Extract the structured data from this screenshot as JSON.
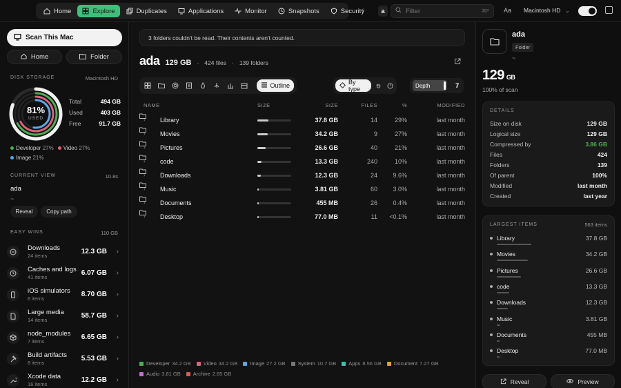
{
  "nav": {
    "items": [
      {
        "label": "Home",
        "icon": "home-icon",
        "active": false
      },
      {
        "label": "Explore",
        "icon": "grid-icon",
        "active": true
      },
      {
        "label": "Duplicates",
        "icon": "copy-icon",
        "active": false
      },
      {
        "label": "Applications",
        "icon": "monitor-icon",
        "active": false
      },
      {
        "label": "Monitor",
        "icon": "pulse-icon",
        "active": false
      },
      {
        "label": "Snapshots",
        "icon": "clock-icon",
        "active": false
      },
      {
        "label": "Security",
        "icon": "shield-icon",
        "active": false
      }
    ],
    "crumb": "a",
    "filter_placeholder": "Filter",
    "filter_shortcut": "⌘F",
    "font_toggle": "Aa",
    "volume": "Macintosh HD"
  },
  "sidebar": {
    "scan_label": "Scan This Mac",
    "home_label": "Home",
    "folder_label": "Folder",
    "disk_label": "Disk Storage",
    "disk_volume": "Macintosh HD",
    "ring_pct": "81%",
    "ring_sub": "USED",
    "used_fraction": 0.81,
    "total_label": "Total",
    "total_value": "494 GB",
    "used_label": "Used",
    "used_value": "403 GB",
    "free_label": "Free",
    "free_value": "91.7 GB",
    "legend": [
      {
        "name": "Developer",
        "pct": "27%",
        "color": "#4caf50"
      },
      {
        "name": "Video",
        "pct": "27%",
        "color": "#e0607e"
      },
      {
        "name": "Image",
        "pct": "21%",
        "color": "#5aa9e6"
      }
    ],
    "current_view_label": "Current View",
    "current_view_time": "10.8s",
    "current_view_name": "ada",
    "current_view_path": "~",
    "reveal_label": "Reveal",
    "copy_path_label": "Copy path",
    "easy_wins_label": "Easy Wins",
    "easy_wins_total": "110 GB",
    "wins": [
      {
        "name": "Downloads",
        "sub": "24 items",
        "value": "12.3 GB",
        "icon": "download-icon"
      },
      {
        "name": "Caches and logs",
        "sub": "41 items",
        "value": "6.07 GB",
        "icon": "clock-icon"
      },
      {
        "name": "iOS simulators",
        "sub": "6 items",
        "value": "8.70 GB",
        "icon": "phone-icon"
      },
      {
        "name": "Large media",
        "sub": "14 items",
        "value": "58.7 GB",
        "icon": "file-icon"
      },
      {
        "name": "node_modules",
        "sub": "7 items",
        "value": "6.65 GB",
        "icon": "package-icon"
      },
      {
        "name": "Build artifacts",
        "sub": "8 items",
        "value": "5.53 GB",
        "icon": "hammer-icon"
      },
      {
        "name": "Xcode data",
        "sub": "16 items",
        "value": "12.2 GB",
        "icon": "wrench-icon"
      }
    ]
  },
  "main": {
    "banner": "3 folders couldn't be read. Their contents aren't counted.",
    "title": "ada",
    "size": "129 GB",
    "files": "424 files",
    "folders": "139 folders",
    "outline_label": "Outline",
    "bytype_label": "By type",
    "depth_label": "Depth",
    "depth_value": "7",
    "columns": {
      "name": "NAME",
      "size_bar": "SIZE",
      "size": "SIZE",
      "files": "FILES",
      "pct": "%",
      "modified": "MODIFIED"
    },
    "rows": [
      {
        "name": "Library",
        "size": "37.8 GB",
        "files": "14",
        "pct": "29%",
        "modified": "last month",
        "share": 0.29
      },
      {
        "name": "Movies",
        "size": "34.2 GB",
        "files": "9",
        "pct": "27%",
        "modified": "last month",
        "share": 0.27
      },
      {
        "name": "Pictures",
        "size": "26.6 GB",
        "files": "40",
        "pct": "21%",
        "modified": "last month",
        "share": 0.21
      },
      {
        "name": "code",
        "size": "13.3 GB",
        "files": "240",
        "pct": "10%",
        "modified": "last month",
        "share": 0.1
      },
      {
        "name": "Downloads",
        "size": "12.3 GB",
        "files": "24",
        "pct": "9.6%",
        "modified": "last month",
        "share": 0.096
      },
      {
        "name": "Music",
        "size": "3.81 GB",
        "files": "60",
        "pct": "3.0%",
        "modified": "last month",
        "share": 0.03
      },
      {
        "name": "Documents",
        "size": "455 MB",
        "files": "26",
        "pct": "0.4%",
        "modified": "last month",
        "share": 0.004
      },
      {
        "name": "Desktop",
        "size": "77.0 MB",
        "files": "11",
        "pct": "<0.1%",
        "modified": "last month",
        "share": 0.001
      }
    ],
    "types": [
      {
        "name": "Developer",
        "value": "34.2 GB",
        "color": "#4caf50"
      },
      {
        "name": "Video",
        "value": "34.2 GB",
        "color": "#e0607e"
      },
      {
        "name": "Image",
        "value": "27.2 GB",
        "color": "#5aa9e6"
      },
      {
        "name": "System",
        "value": "10.7 GB",
        "color": "#777777"
      },
      {
        "name": "Apps",
        "value": "8.56 GB",
        "color": "#3cc0b0"
      },
      {
        "name": "Document",
        "value": "7.27 GB",
        "color": "#e0a030"
      },
      {
        "name": "Audio",
        "value": "3.81 GB",
        "color": "#c070d0"
      },
      {
        "name": "Archive",
        "value": "2.65 GB",
        "color": "#d06050"
      }
    ]
  },
  "inspector": {
    "name": "ada",
    "tag": "Folder",
    "path": "~",
    "size_num": "129",
    "size_unit": "GB",
    "scan_pct": "100% of scan",
    "details_label": "Details",
    "details": [
      {
        "label": "Size on disk",
        "value": "129 GB"
      },
      {
        "label": "Logical size",
        "value": "129 GB"
      },
      {
        "label": "Compressed by",
        "value": "3.86 GB",
        "color": "#4caf50"
      },
      {
        "label": "Files",
        "value": "424"
      },
      {
        "label": "Folders",
        "value": "139"
      },
      {
        "label": "Of parent",
        "value": "100%"
      },
      {
        "label": "Modified",
        "value": "last month"
      },
      {
        "label": "Created",
        "value": "last year"
      }
    ],
    "largest_label": "Largest Items",
    "largest_count": "563 items",
    "largest": [
      {
        "name": "Library",
        "value": "37.8 GB",
        "share": 1.0
      },
      {
        "name": "Movies",
        "value": "34.2 GB",
        "share": 0.9
      },
      {
        "name": "Pictures",
        "value": "26.6 GB",
        "share": 0.7
      },
      {
        "name": "code",
        "value": "13.3 GB",
        "share": 0.35
      },
      {
        "name": "Downloads",
        "value": "12.3 GB",
        "share": 0.32
      },
      {
        "name": "Music",
        "value": "3.81 GB",
        "share": 0.1
      },
      {
        "name": "Documents",
        "value": "455 MB",
        "share": 0.03
      },
      {
        "name": "Desktop",
        "value": "77.0 MB",
        "share": 0.01
      }
    ],
    "reveal_label": "Reveal",
    "preview_label": "Preview"
  }
}
